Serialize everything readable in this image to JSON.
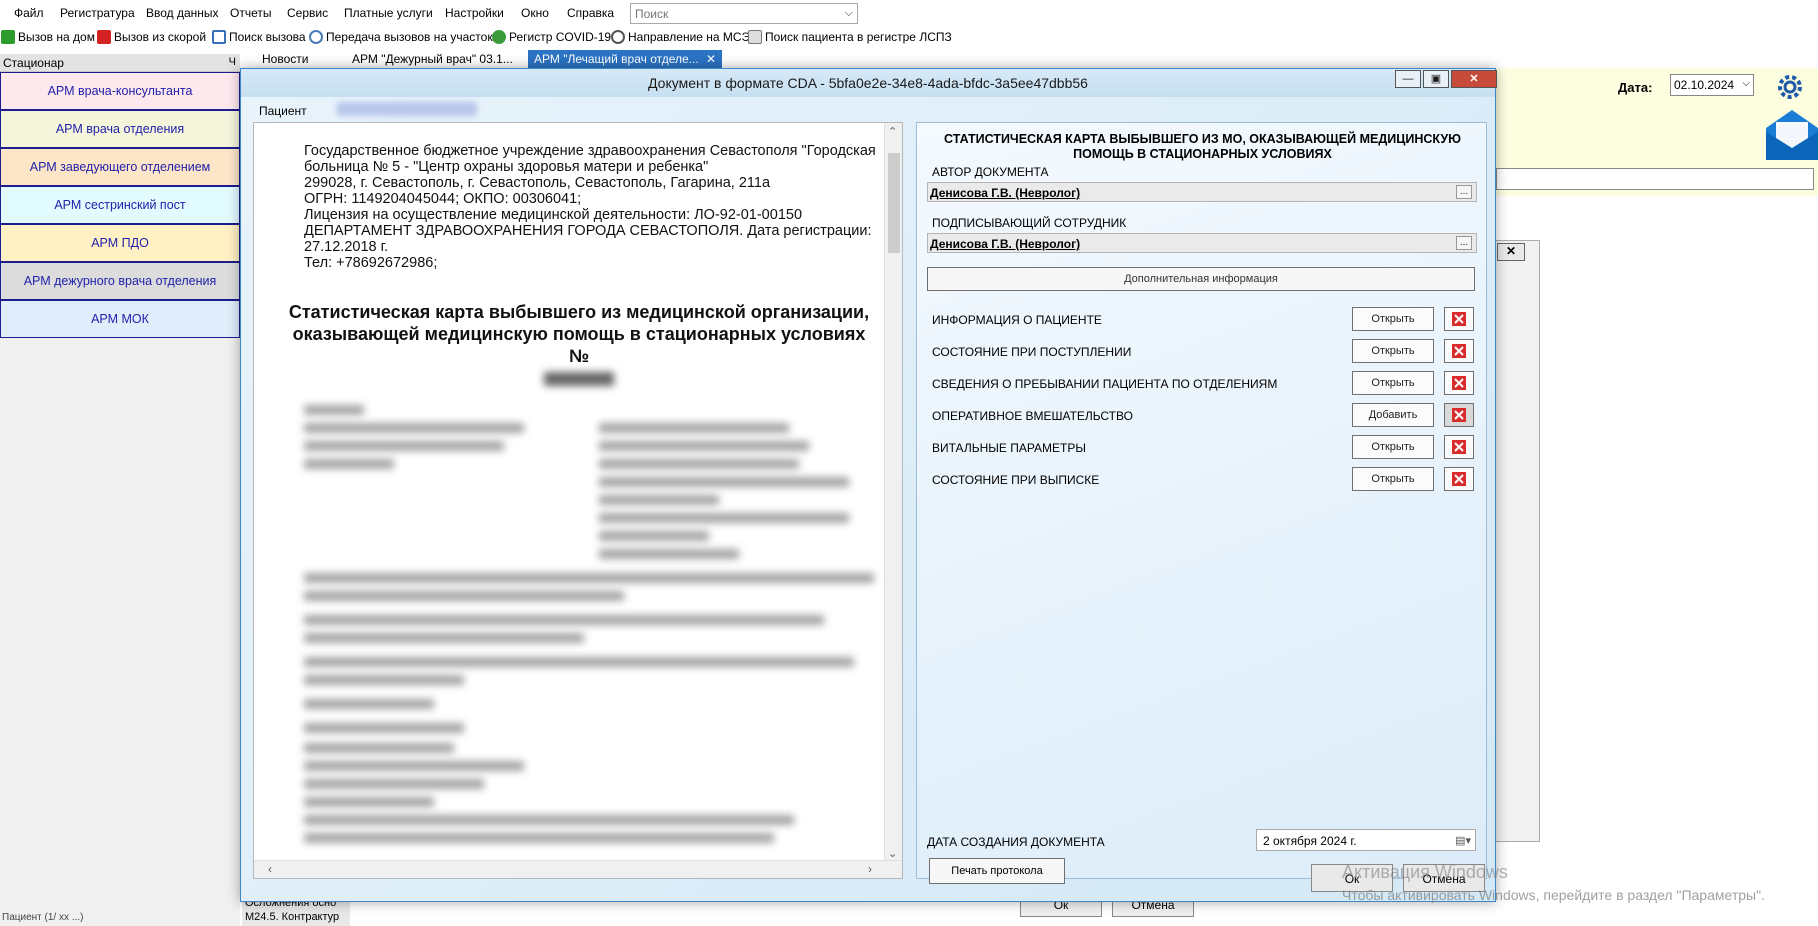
{
  "menu": {
    "items": [
      "Файл",
      "Регистратура",
      "Ввод данных",
      "Отчеты",
      "Сервис",
      "Платные услуги",
      "Настройки",
      "Окно",
      "Справка"
    ],
    "search_placeholder": "Поиск"
  },
  "toolbar": {
    "items": [
      {
        "label": "Вызов на дом",
        "icon": "home-call-icon",
        "color": "#2e9b2e"
      },
      {
        "label": "Вызов из скорой",
        "icon": "ambulance-icon",
        "color": "#d32222"
      },
      {
        "label": "Поиск вызова",
        "icon": "search-call-icon",
        "color": "#3a6fb5"
      },
      {
        "label": "Передача вызовов на участок",
        "icon": "transfer-icon",
        "color": "#4a7bb8"
      },
      {
        "label": "Регистр COVID-19",
        "icon": "virus-icon",
        "color": "#3c9a3c"
      },
      {
        "label": "Направление на МСЭ",
        "icon": "referral-icon",
        "color": "#555555"
      },
      {
        "label": "Поиск пациента в регистре ЛСПЗ",
        "icon": "registry-icon",
        "color": "#777777"
      }
    ]
  },
  "left_panel": {
    "title": "Стационар",
    "pin": "Ч",
    "arms": [
      {
        "label": "АРМ врача-консультанта",
        "bg": "#fde8ee"
      },
      {
        "label": "АРМ врача отделения",
        "bg": "#f5f5dc"
      },
      {
        "label": "АРМ заведующего отделением",
        "bg": "#fde5c8"
      },
      {
        "label": "АРМ сестринский пост",
        "bg": "#e2fbff"
      },
      {
        "label": "АРМ ПДО",
        "bg": "#fff1c4"
      },
      {
        "label": "АРМ дежурного врача отделения",
        "bg": "#dcdcdc"
      },
      {
        "label": "АРМ МОК",
        "bg": "#e0eefb"
      }
    ]
  },
  "tabs": [
    {
      "label": "Новости"
    },
    {
      "label": "АРМ \"Дежурный врач\" 03.1..."
    },
    {
      "label": "АРМ \"Лечащий врач отделе...",
      "active": true
    }
  ],
  "background": {
    "date_label": "Дата:",
    "date_value": "02.10.2024",
    "bottom_text_1": "Осложнения осно",
    "bottom_text_2": "M24.5. Контрактур",
    "bottom_text_3": "Пациент (1/ хх ...)",
    "ok": "Ок",
    "cancel": "Отмена"
  },
  "dialog": {
    "title": "Документ в формате CDA - 5bfa0e2e-34e8-4ada-bfdc-3a5ee47dbb56",
    "patient_label": "Пациент",
    "doc_header": [
      "Государственное бюджетное учреждение здравоохранения Севастополя \"Городская",
      "больница № 5 - \"Центр охраны здоровья матери и ребенка\"",
      "299028, г. Севастополь, г. Севастополь, Севастополь, Гагарина, 211а",
      "ОГРН: 1149204045044; ОКПО: 00306041;",
      "Лицензия на осуществление медицинской деятельности: ЛО-92-01-00150",
      "ДЕПАРТАМЕНТ ЗДРАВООХРАНЕНИЯ ГОРОДА СЕВАСТОПОЛЯ. Дата регистрации:",
      "27.12.2018 г.",
      "Тел: +78692672986;"
    ],
    "doc_title_line1": "Статистическая карта выбывшего из медицинской организации,",
    "doc_title_line2": "оказывающей медицинскую помощь в стационарных условиях №",
    "form": {
      "title_line1": "СТАТИСТИЧЕСКАЯ КАРТА ВЫБЫВШЕГО ИЗ МО, ОКАЗЫВАЮЩЕЙ МЕДИЦИНСКУЮ",
      "title_line2": "ПОМОЩЬ В СТАЦИОНАРНЫХ УСЛОВИЯХ",
      "author_label": "АВТОР ДОКУМЕНТА",
      "author_value": "Денисова Г.В. (Невролог)",
      "signer_label": "ПОДПИСЫВАЮЩИЙ СОТРУДНИК",
      "signer_value": "Денисова Г.В. (Невролог)",
      "add_info": "Дополнительная информация",
      "sections": [
        {
          "label": "ИНФОРМАЦИЯ О ПАЦИЕНТЕ",
          "button": "Открыть"
        },
        {
          "label": "СОСТОЯНИЕ ПРИ ПОСТУПЛЕНИИ",
          "button": "Открыть"
        },
        {
          "label": "СВЕДЕНИЯ О ПРЕБЫВАНИИ ПАЦИЕНТА ПО ОТДЕЛЕНИЯМ",
          "button": "Открыть"
        },
        {
          "label": "ОПЕРАТИВНОЕ ВМЕШАТЕЛЬСТВО",
          "button": "Добавить",
          "delete_disabled": true
        },
        {
          "label": "ВИТАЛЬНЫЕ ПАРАМЕТРЫ",
          "button": "Открыть"
        },
        {
          "label": "СОСТОЯНИЕ ПРИ ВЫПИСКЕ",
          "button": "Открыть"
        }
      ],
      "date_label": "ДАТА СОЗДАНИЯ ДОКУМЕНТА",
      "date_value": "2  октября  2024 г.",
      "print_button": "Печать протокола"
    },
    "ok": "Ок",
    "cancel": "Отмена"
  },
  "watermark": {
    "line1": "Активация Windows",
    "line2": "Чтобы активировать Windows, перейдите в раздел \"Параметры\"."
  }
}
